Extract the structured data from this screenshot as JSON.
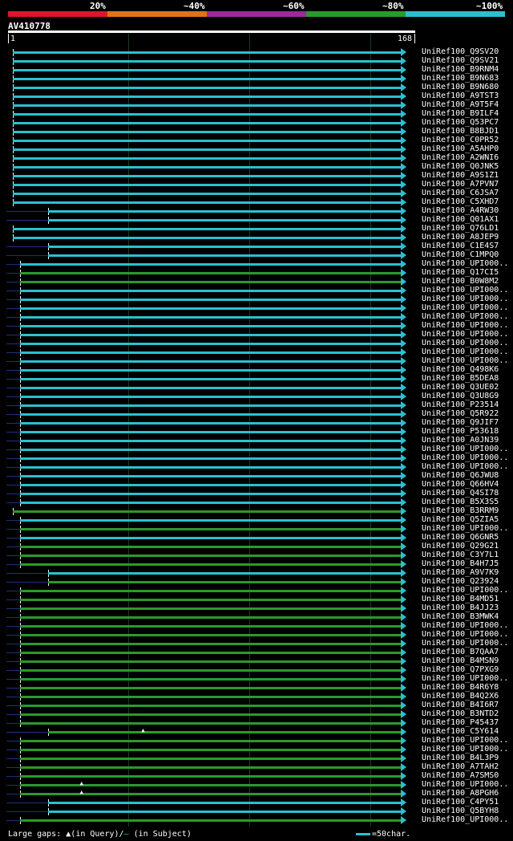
{
  "legend": {
    "labels": [
      "20%",
      "~40%",
      "~60%",
      "~80%",
      "~100%"
    ],
    "colors": [
      "#e0142c",
      "#e0731a",
      "#9a2b9a",
      "#2b9a2b",
      "#2bc0cf"
    ]
  },
  "query": {
    "name": "AV410778",
    "start": "1",
    "end": "168"
  },
  "footer": {
    "large_gaps": "Large gaps:",
    "in_query": "(in Query)/",
    "dash": "—",
    "in_subject": "(in Subject)"
  },
  "scale": {
    "label": "=50char."
  },
  "hits": [
    {
      "name": "UniRef100_Q9SV20",
      "start": 1,
      "end": 165,
      "color": "#2bc0cf"
    },
    {
      "name": "UniRef100_Q9SV21",
      "start": 1,
      "end": 165,
      "color": "#2bc0cf"
    },
    {
      "name": "UniRef100_B9RNM4",
      "start": 1,
      "end": 165,
      "color": "#2bc0cf"
    },
    {
      "name": "UniRef100_B9N683",
      "start": 1,
      "end": 165,
      "color": "#2bc0cf"
    },
    {
      "name": "UniRef100_B9N680",
      "start": 1,
      "end": 165,
      "color": "#2bc0cf"
    },
    {
      "name": "UniRef100_A9TST3",
      "start": 1,
      "end": 165,
      "color": "#2bc0cf"
    },
    {
      "name": "UniRef100_A9T5F4",
      "start": 1,
      "end": 165,
      "color": "#2bc0cf"
    },
    {
      "name": "UniRef100_B9ILF4",
      "start": 1,
      "end": 165,
      "color": "#2bc0cf"
    },
    {
      "name": "UniRef100_Q53PC7",
      "start": 1,
      "end": 165,
      "color": "#2bc0cf"
    },
    {
      "name": "UniRef100_B8BJD1",
      "start": 1,
      "end": 165,
      "color": "#2bc0cf"
    },
    {
      "name": "UniRef100_C0PR52",
      "start": 1,
      "end": 165,
      "color": "#2bc0cf"
    },
    {
      "name": "UniRef100_A5AHP0",
      "start": 1,
      "end": 165,
      "color": "#2bc0cf"
    },
    {
      "name": "UniRef100_A2WNI6",
      "start": 1,
      "end": 165,
      "color": "#2bc0cf"
    },
    {
      "name": "UniRef100_Q0JNK5",
      "start": 1,
      "end": 165,
      "color": "#2bc0cf"
    },
    {
      "name": "UniRef100_A9S1Z1",
      "start": 1,
      "end": 165,
      "color": "#2bc0cf"
    },
    {
      "name": "UniRef100_A7PVN7",
      "start": 1,
      "end": 165,
      "color": "#2bc0cf"
    },
    {
      "name": "UniRef100_C6JSA7",
      "start": 1,
      "end": 165,
      "color": "#2bc0cf"
    },
    {
      "name": "UniRef100_C5XHD7",
      "start": 1,
      "end": 165,
      "color": "#2bc0cf"
    },
    {
      "name": "UniRef100_A4RW30",
      "start": 16,
      "end": 165,
      "color": "#2bc0cf"
    },
    {
      "name": "UniRef100_Q01AX1",
      "start": 16,
      "end": 165,
      "color": "#2bc0cf"
    },
    {
      "name": "UniRef100_Q76LD1",
      "start": 1,
      "end": 165,
      "color": "#2bc0cf"
    },
    {
      "name": "UniRef100_A8JEP9",
      "start": 1,
      "end": 165,
      "color": "#2bc0cf"
    },
    {
      "name": "UniRef100_C1E4S7",
      "start": 16,
      "end": 165,
      "color": "#2bc0cf"
    },
    {
      "name": "UniRef100_C1MPQ0",
      "start": 16,
      "end": 165,
      "color": "#2bc0cf"
    },
    {
      "name": "UniRef100_UPI000..",
      "start": 4,
      "end": 165,
      "color": "#2bc0cf"
    },
    {
      "name": "UniRef100_Q17CI5",
      "start": 4,
      "end": 165,
      "color": "#2b9a2b"
    },
    {
      "name": "UniRef100_B0W8M2",
      "start": 4,
      "end": 165,
      "color": "#2b9a2b"
    },
    {
      "name": "UniRef100_UPI000..",
      "start": 4,
      "end": 165,
      "color": "#2bc0cf"
    },
    {
      "name": "UniRef100_UPI000..",
      "start": 4,
      "end": 165,
      "color": "#2bc0cf"
    },
    {
      "name": "UniRef100_UPI000..",
      "start": 4,
      "end": 165,
      "color": "#2bc0cf"
    },
    {
      "name": "UniRef100_UPI000..",
      "start": 4,
      "end": 165,
      "color": "#2bc0cf"
    },
    {
      "name": "UniRef100_UPI000..",
      "start": 4,
      "end": 165,
      "color": "#2bc0cf"
    },
    {
      "name": "UniRef100_UPI000..",
      "start": 4,
      "end": 165,
      "color": "#2bc0cf"
    },
    {
      "name": "UniRef100_UPI000..",
      "start": 4,
      "end": 165,
      "color": "#2bc0cf"
    },
    {
      "name": "UniRef100_UPI000..",
      "start": 4,
      "end": 165,
      "color": "#2bc0cf"
    },
    {
      "name": "UniRef100_UPI000..",
      "start": 4,
      "end": 165,
      "color": "#2bc0cf"
    },
    {
      "name": "UniRef100_Q498K6",
      "start": 4,
      "end": 165,
      "color": "#2bc0cf"
    },
    {
      "name": "UniRef100_B5DEA8",
      "start": 4,
      "end": 165,
      "color": "#2bc0cf"
    },
    {
      "name": "UniRef100_Q3UE02",
      "start": 4,
      "end": 165,
      "color": "#2bc0cf"
    },
    {
      "name": "UniRef100_Q3U8G9",
      "start": 4,
      "end": 165,
      "color": "#2bc0cf"
    },
    {
      "name": "UniRef100_P23514",
      "start": 4,
      "end": 165,
      "color": "#2bc0cf"
    },
    {
      "name": "UniRef100_Q5R922",
      "start": 4,
      "end": 165,
      "color": "#2bc0cf"
    },
    {
      "name": "UniRef100_Q9JIF7",
      "start": 4,
      "end": 165,
      "color": "#2bc0cf"
    },
    {
      "name": "UniRef100_P53618",
      "start": 4,
      "end": 165,
      "color": "#2bc0cf"
    },
    {
      "name": "UniRef100_A0JN39",
      "start": 4,
      "end": 165,
      "color": "#2bc0cf"
    },
    {
      "name": "UniRef100_UPI000..",
      "start": 4,
      "end": 165,
      "color": "#2bc0cf"
    },
    {
      "name": "UniRef100_UPI000..",
      "start": 4,
      "end": 165,
      "color": "#2bc0cf"
    },
    {
      "name": "UniRef100_UPI000..",
      "start": 4,
      "end": 165,
      "color": "#2bc0cf"
    },
    {
      "name": "UniRef100_Q6JWU8",
      "start": 4,
      "end": 165,
      "color": "#2bc0cf"
    },
    {
      "name": "UniRef100_Q66HV4",
      "start": 4,
      "end": 165,
      "color": "#2bc0cf"
    },
    {
      "name": "UniRef100_Q4SI78",
      "start": 4,
      "end": 165,
      "color": "#2bc0cf"
    },
    {
      "name": "UniRef100_B5X3S5",
      "start": 4,
      "end": 165,
      "color": "#2bc0cf"
    },
    {
      "name": "UniRef100_B3RRM9",
      "start": 1,
      "end": 165,
      "color": "#2b9a2b"
    },
    {
      "name": "UniRef100_Q5ZIA5",
      "start": 4,
      "end": 165,
      "color": "#2bc0cf"
    },
    {
      "name": "UniRef100_UPI000..",
      "start": 4,
      "end": 165,
      "color": "#2b9a2b"
    },
    {
      "name": "UniRef100_Q6GNR5",
      "start": 4,
      "end": 165,
      "color": "#2bc0cf"
    },
    {
      "name": "UniRef100_Q29G21",
      "start": 4,
      "end": 165,
      "color": "#2b9a2b"
    },
    {
      "name": "UniRef100_C3Y7L1",
      "start": 4,
      "end": 165,
      "color": "#2b9a2b"
    },
    {
      "name": "UniRef100_B4H7J5",
      "start": 4,
      "end": 165,
      "color": "#2b9a2b"
    },
    {
      "name": "UniRef100_A9V7K9",
      "start": 16,
      "end": 165,
      "color": "#2bc0cf"
    },
    {
      "name": "UniRef100_Q23924",
      "start": 16,
      "end": 165,
      "color": "#2b9a2b"
    },
    {
      "name": "UniRef100_UPI000..",
      "start": 4,
      "end": 165,
      "color": "#2b9a2b"
    },
    {
      "name": "UniRef100_B4MD51",
      "start": 4,
      "end": 165,
      "color": "#2b9a2b"
    },
    {
      "name": "UniRef100_B4JJ23",
      "start": 4,
      "end": 165,
      "color": "#2b9a2b"
    },
    {
      "name": "UniRef100_B3MWK4",
      "start": 4,
      "end": 165,
      "color": "#2b9a2b"
    },
    {
      "name": "UniRef100_UPI000..",
      "start": 4,
      "end": 165,
      "color": "#2b9a2b"
    },
    {
      "name": "UniRef100_UPI000..",
      "start": 4,
      "end": 165,
      "color": "#2b9a2b"
    },
    {
      "name": "UniRef100_UPI000..",
      "start": 4,
      "end": 165,
      "color": "#2b9a2b"
    },
    {
      "name": "UniRef100_B7QAA7",
      "start": 4,
      "end": 165,
      "color": "#2b9a2b"
    },
    {
      "name": "UniRef100_B4MSN9",
      "start": 4,
      "end": 165,
      "color": "#2b9a2b"
    },
    {
      "name": "UniRef100_Q7PXG9",
      "start": 4,
      "end": 165,
      "color": "#2b9a2b"
    },
    {
      "name": "UniRef100_UPI000..",
      "start": 4,
      "end": 165,
      "color": "#2b9a2b"
    },
    {
      "name": "UniRef100_B4R6Y8",
      "start": 4,
      "end": 165,
      "color": "#2b9a2b"
    },
    {
      "name": "UniRef100_B4Q2X6",
      "start": 4,
      "end": 165,
      "color": "#2b9a2b"
    },
    {
      "name": "UniRef100_B4I6R7",
      "start": 4,
      "end": 165,
      "color": "#2b9a2b"
    },
    {
      "name": "UniRef100_B3NTD2",
      "start": 4,
      "end": 165,
      "color": "#2b9a2b"
    },
    {
      "name": "UniRef100_P45437",
      "start": 4,
      "end": 165,
      "color": "#2b9a2b"
    },
    {
      "name": "UniRef100_C5Y614",
      "start": 16,
      "end": 165,
      "color": "#2b9a2b",
      "ins": 56
    },
    {
      "name": "UniRef100_UPI000..",
      "start": 4,
      "end": 165,
      "color": "#2b9a2b"
    },
    {
      "name": "UniRef100_UPI000..",
      "start": 4,
      "end": 165,
      "color": "#2b9a2b"
    },
    {
      "name": "UniRef100_B4L3P9",
      "start": 4,
      "end": 165,
      "color": "#2b9a2b"
    },
    {
      "name": "UniRef100_A7TAH2",
      "start": 4,
      "end": 165,
      "color": "#2b9a2b"
    },
    {
      "name": "UniRef100_A7SMS0",
      "start": 4,
      "end": 165,
      "color": "#2b9a2b"
    },
    {
      "name": "UniRef100_UPI000..",
      "start": 4,
      "end": 165,
      "color": "#2b9a2b",
      "ins": 30
    },
    {
      "name": "UniRef100_A8PGH6",
      "start": 4,
      "end": 165,
      "color": "#2b9a2b",
      "ins": 30
    },
    {
      "name": "UniRef100_C4PY51",
      "start": 16,
      "end": 165,
      "color": "#2bc0cf"
    },
    {
      "name": "UniRef100_Q5BYH8",
      "start": 16,
      "end": 165,
      "color": "#2bc0cf"
    },
    {
      "name": "UniRef100_UPI000..",
      "start": 4,
      "end": 165,
      "color": "#2b9a2b"
    }
  ]
}
